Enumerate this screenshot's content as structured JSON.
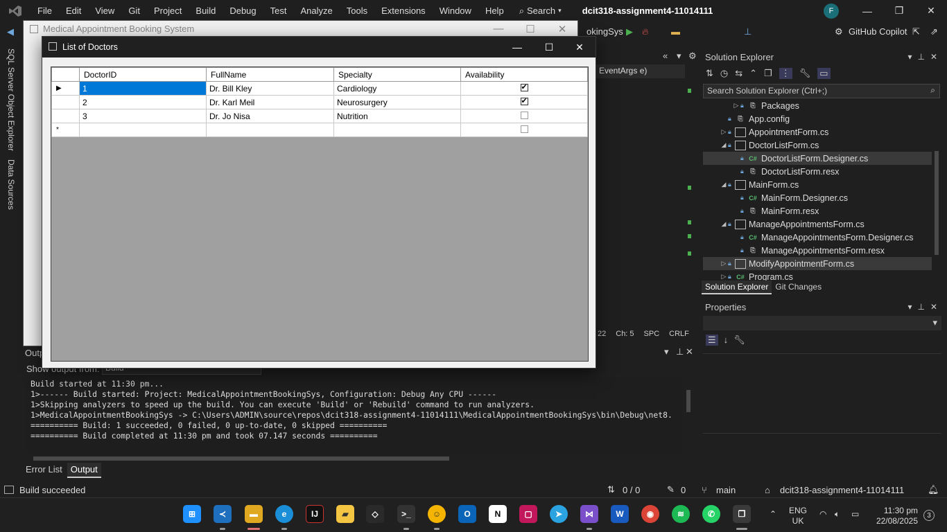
{
  "menubar": {
    "items": [
      "File",
      "Edit",
      "View",
      "Git",
      "Project",
      "Build",
      "Debug",
      "Test",
      "Analyze",
      "Tools",
      "Extensions",
      "Window",
      "Help"
    ],
    "search_label": "Search",
    "solution_title": "dcit318-assignment4-11014111",
    "avatar_letter": "F"
  },
  "toolbar": {
    "startup_project": "okingSys",
    "copilot_label": "GitHub Copilot"
  },
  "side_tabs": [
    "SQL Server Object Explorer",
    "Data Sources"
  ],
  "editor": {
    "member_dropdown": "EventArgs e)",
    "status": [
      "22",
      "Ch: 5",
      "SPC",
      "CRLF"
    ]
  },
  "output": {
    "title": "Outp",
    "show_output_from_label": "Show output from:",
    "source": "Build",
    "lines": [
      "Build started at 11:30 pm...",
      "1>------ Build started: Project: MedicalAppointmentBookingSys, Configuration: Debug Any CPU ------",
      "1>Skipping analyzers to speed up the build. You can execute 'Build' or 'Rebuild' command to run analyzers.",
      "1>MedicalAppointmentBookingSys -> C:\\Users\\ADMIN\\source\\repos\\dcit318-assignment4-11014111\\MedicalAppointmentBookingSys\\bin\\Debug\\net8.",
      "========== Build: 1 succeeded, 0 failed, 0 up-to-date, 0 skipped ==========",
      "========== Build completed at 11:30 pm and took 07.147 seconds =========="
    ]
  },
  "bottom_tabs": [
    "Error List",
    "Output"
  ],
  "solution_explorer": {
    "title": "Solution Explorer",
    "search_placeholder": "Search Solution Explorer (Ctrl+;)",
    "items": [
      {
        "label": "Packages",
        "indent": 2,
        "expander": "right",
        "icon": "res"
      },
      {
        "label": "App.config",
        "indent": 1,
        "expander": "",
        "icon": "res"
      },
      {
        "label": "AppointmentForm.cs",
        "indent": 1,
        "expander": "right",
        "icon": "form"
      },
      {
        "label": "DoctorListForm.cs",
        "indent": 1,
        "expander": "down",
        "icon": "form"
      },
      {
        "label": "DoctorListForm.Designer.cs",
        "indent": 2,
        "expander": "",
        "icon": "cs",
        "selected": true
      },
      {
        "label": "DoctorListForm.resx",
        "indent": 2,
        "expander": "",
        "icon": "res"
      },
      {
        "label": "MainForm.cs",
        "indent": 1,
        "expander": "down",
        "icon": "form"
      },
      {
        "label": "MainForm.Designer.cs",
        "indent": 2,
        "expander": "",
        "icon": "cs"
      },
      {
        "label": "MainForm.resx",
        "indent": 2,
        "expander": "",
        "icon": "res"
      },
      {
        "label": "ManageAppointmentsForm.cs",
        "indent": 1,
        "expander": "down",
        "icon": "form"
      },
      {
        "label": "ManageAppointmentsForm.Designer.cs",
        "indent": 2,
        "expander": "",
        "icon": "cs"
      },
      {
        "label": "ManageAppointmentsForm.resx",
        "indent": 2,
        "expander": "",
        "icon": "res"
      },
      {
        "label": "ModifyAppointmentForm.cs",
        "indent": 1,
        "expander": "right",
        "icon": "form",
        "hover": true
      },
      {
        "label": "Program.cs",
        "indent": 1,
        "expander": "right",
        "icon": "cs"
      }
    ],
    "tabs": [
      "Solution Explorer",
      "Git Changes"
    ]
  },
  "properties": {
    "title": "Properties"
  },
  "statusbar": {
    "message": "Build succeeded",
    "line_info": "0 / 0",
    "pencil_count": "0",
    "branch": "main",
    "repo": "dcit318-assignment4-11014111"
  },
  "main_window": {
    "title": "Medical Appointment Booking System"
  },
  "doctor_dialog": {
    "title": "List of Doctors",
    "columns": [
      "DoctorID",
      "FullName",
      "Specialty",
      "Availability"
    ],
    "rows": [
      {
        "id": "1",
        "name": "Dr. Bill Kley",
        "specialty": "Cardiology",
        "available": true
      },
      {
        "id": "2",
        "name": "Dr. Karl Meil",
        "specialty": "Neurosurgery",
        "available": true
      },
      {
        "id": "3",
        "name": "Dr. Jo Nisa",
        "specialty": "Nutrition",
        "available": false
      }
    ],
    "new_row_marker": "*"
  },
  "taskbar": {
    "lang": "ENG",
    "region": "UK",
    "time": "11:30 pm",
    "date": "22/08/2025",
    "notifications": "3"
  }
}
